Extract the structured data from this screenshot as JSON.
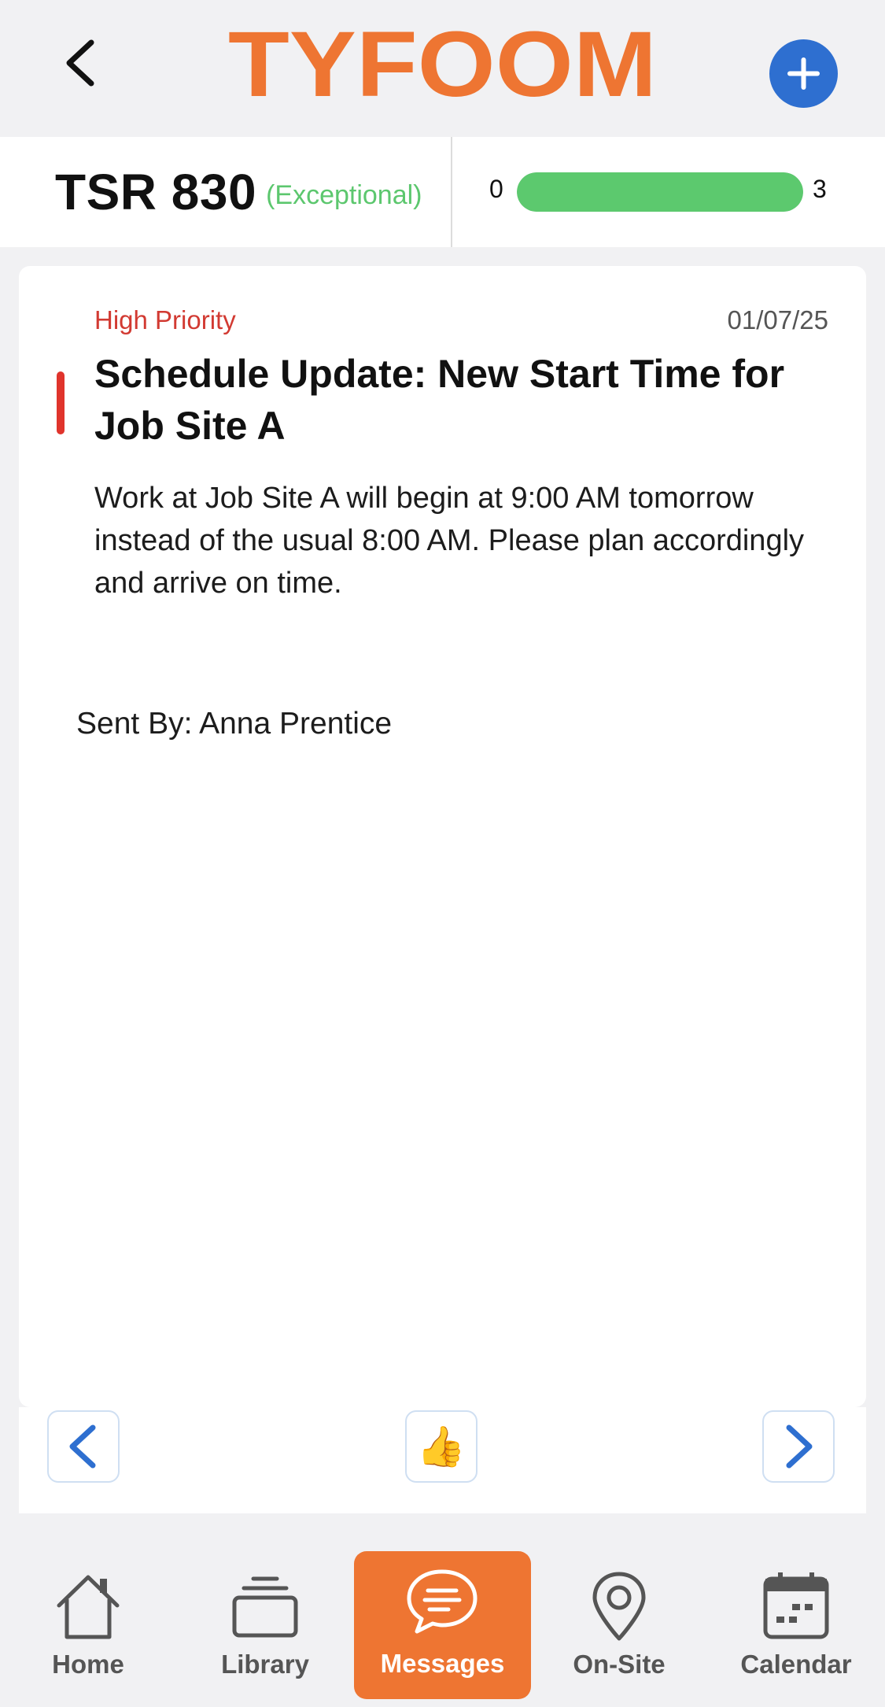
{
  "header": {
    "logo_text": "TYFOOM",
    "back_icon": "chevron-left-icon",
    "add_icon": "plus-icon",
    "colors": {
      "brand": "#ee7532",
      "add_button": "#2e6fd0"
    }
  },
  "score": {
    "label": "TSR 830",
    "status": "(Exceptional)",
    "range_min": "0",
    "range_max": "3",
    "progress_fraction": 1.0,
    "colors": {
      "status": "#5cc76e",
      "fill": "#5cc96e"
    }
  },
  "message": {
    "priority": "High Priority",
    "date": "01/07/25",
    "title": "Schedule Update: New Start Time for Job Site A",
    "body": "Work at Job Site A will begin at 9:00 AM tomorrow instead of the usual 8:00 AM. Please plan accordingly and arrive on time.",
    "sent_by": "Sent By: Anna Prentice",
    "colors": {
      "priority": "#d23a32",
      "priority_bar": "#e0342c"
    }
  },
  "actions": {
    "prev_icon": "chevron-left-icon",
    "like_icon": "thumbs-up-icon",
    "like_glyph": "👍",
    "next_icon": "chevron-right-icon"
  },
  "tabbar": {
    "active": "Messages",
    "tabs": [
      {
        "label": "Home",
        "icon": "home-icon"
      },
      {
        "label": "Library",
        "icon": "library-icon"
      },
      {
        "label": "Messages",
        "icon": "chat-bubble-icon"
      },
      {
        "label": "On-Site",
        "icon": "location-pin-icon"
      },
      {
        "label": "Calendar",
        "icon": "calendar-icon"
      }
    ]
  }
}
